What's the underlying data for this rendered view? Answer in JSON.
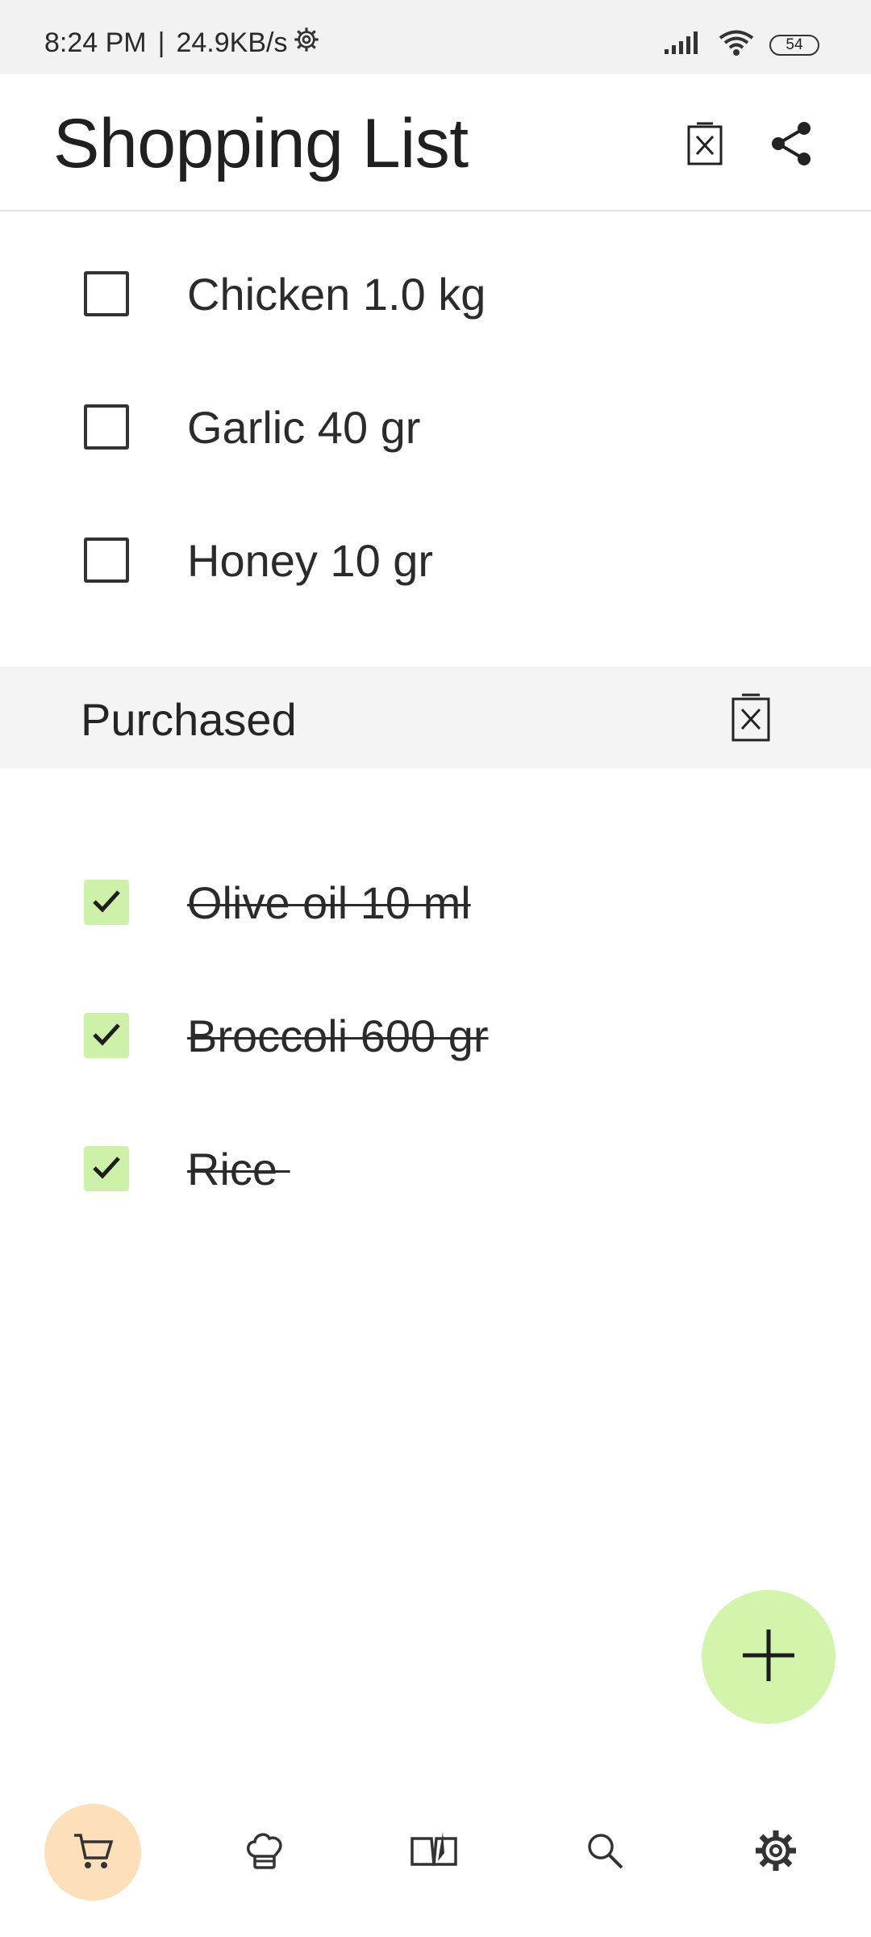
{
  "status_bar": {
    "time": "8:24 PM",
    "speed": "24.9KB/s",
    "battery": "54"
  },
  "header": {
    "title": "Shopping List",
    "clear_icon": "delete-box-icon",
    "share_icon": "share-icon"
  },
  "pending_items": [
    {
      "label": "Chicken 1.0 kg",
      "checked": false
    },
    {
      "label": "Garlic 40 gr",
      "checked": false
    },
    {
      "label": "Honey 10 gr",
      "checked": false
    }
  ],
  "purchased_section": {
    "title": "Purchased",
    "clear_icon": "delete-box-icon"
  },
  "purchased_items": [
    {
      "label": "Olive oil 10 ml",
      "checked": true
    },
    {
      "label": "Broccoli 600 gr",
      "checked": true
    },
    {
      "label": "Rice ",
      "checked": true
    }
  ],
  "fab": {
    "icon": "plus-icon"
  },
  "bottom_nav": {
    "items": [
      {
        "icon": "cart-icon",
        "active": true
      },
      {
        "icon": "chef-hat-icon",
        "active": false
      },
      {
        "icon": "book-icon",
        "active": false
      },
      {
        "icon": "search-icon",
        "active": false
      },
      {
        "icon": "gear-icon",
        "active": false
      }
    ]
  },
  "colors": {
    "checked_fill": "#cdf1a9",
    "fab": "#d3f4ab",
    "nav_active": "#fde0ba",
    "section_bg": "#f4f4f4",
    "status_bg": "#f2f2f2"
  }
}
